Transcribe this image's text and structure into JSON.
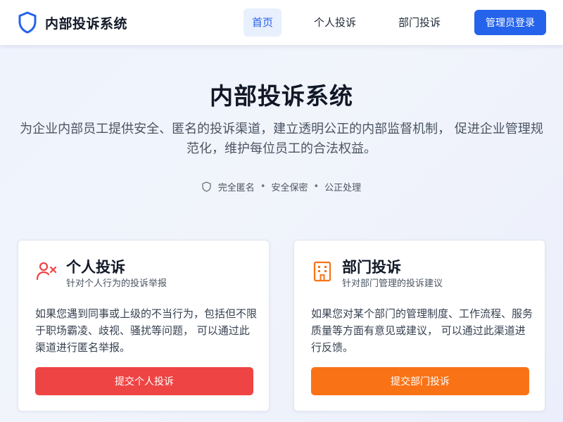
{
  "brand": {
    "title": "内部投诉系统"
  },
  "nav": {
    "items": [
      {
        "label": "首页",
        "active": true
      },
      {
        "label": "个人投诉",
        "active": false
      },
      {
        "label": "部门投诉",
        "active": false
      }
    ],
    "login_label": "管理员登录"
  },
  "hero": {
    "title": "内部投诉系统",
    "description": "为企业内部员工提供安全、匿名的投诉渠道，建立透明公正的内部监督机制， 促进企业管理规范化，维护每位员工的合法权益。",
    "tags": [
      "完全匿名",
      "安全保密",
      "公正处理"
    ],
    "separator": "•"
  },
  "cards": {
    "personal": {
      "title": "个人投诉",
      "subtitle": "针对个人行为的投诉举报",
      "body": "如果您遇到同事或上级的不当行为，包括但不限于职场霸凌、歧视、骚扰等问题， 可以通过此渠道进行匿名举报。",
      "button_label": "提交个人投诉",
      "icon": "user-x-icon"
    },
    "department": {
      "title": "部门投诉",
      "subtitle": "针对部门管理的投诉建议",
      "body": "如果您对某个部门的管理制度、工作流程、服务质量等方面有意见或建议， 可以通过此渠道进行反馈。",
      "button_label": "提交部门投诉",
      "icon": "building-icon"
    }
  },
  "colors": {
    "primary": "#2563eb",
    "personal_accent": "#ef4444",
    "department_accent": "#f97316"
  }
}
